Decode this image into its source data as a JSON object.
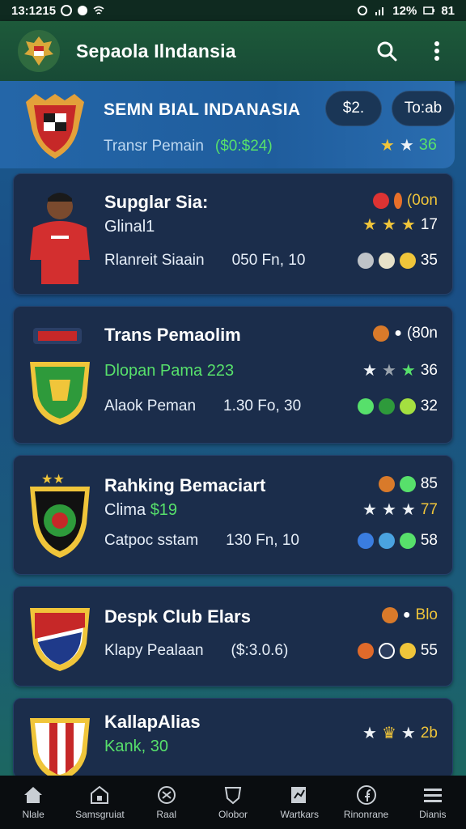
{
  "status_bar": {
    "time": "13:1215",
    "battery": "12%",
    "extra": "81"
  },
  "app": {
    "title": "Sepaola Ilndansia"
  },
  "featured": {
    "title": "SEMN BIAL INDANASIA",
    "subtitle": "Transr Pemain",
    "subtitle_value": "($0:$24)",
    "button_1": "$2.",
    "button_2": "To:ab",
    "rating": "36"
  },
  "cards": [
    {
      "name": "Supglar Sia:",
      "line2": "Glinal1",
      "line3_a": "Rlanreit Siaain",
      "line3_b": "050 Fn, 10",
      "meta_top": "(0on",
      "meta_mid": "17",
      "meta_bot": "35"
    },
    {
      "name": "Trans Pemaolim",
      "line2": "Dlopan Pama 223",
      "line3_a": "Alaok Peman",
      "line3_b": "1.30 Fo, 30",
      "meta_top": "(80n",
      "meta_mid": "36",
      "meta_bot": "32"
    },
    {
      "name": "Rahking Bemaciart",
      "line2_a": "Clima",
      "line2_b": "$19",
      "line3_a": "Catpoc sstam",
      "line3_b": "130 Fn, 10",
      "meta_top": "85",
      "meta_mid": "77",
      "meta_bot": "58"
    },
    {
      "name": "Despk Club Elars",
      "line3_a": "Klapy Pealaan",
      "line3_b": "($:3.0.6)",
      "meta_top": "Blo",
      "meta_mid": "",
      "meta_bot": "55"
    },
    {
      "name": "KallapAlias",
      "line2": "Kank, 30",
      "meta_top": "2b"
    }
  ],
  "nav": [
    {
      "label": "Nlale",
      "icon": "home-icon"
    },
    {
      "label": "Samsgruiat",
      "icon": "store-icon"
    },
    {
      "label": "Raal",
      "icon": "ball-icon"
    },
    {
      "label": "Olobor",
      "icon": "shield-icon"
    },
    {
      "label": "Wartkars",
      "icon": "chart-icon"
    },
    {
      "label": "Rinonrane",
      "icon": "facebook-icon"
    },
    {
      "label": "Dianis",
      "icon": "menu-icon"
    }
  ],
  "colors": {
    "accent_green": "#57e06b",
    "gold": "#f0c53a",
    "card_bg": "#1b2d4b"
  }
}
